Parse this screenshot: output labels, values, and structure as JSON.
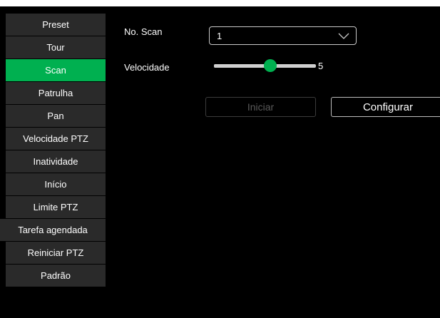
{
  "menu": {
    "items": [
      {
        "label": "Preset"
      },
      {
        "label": "Tour"
      },
      {
        "label": "Scan"
      },
      {
        "label": "Patrulha"
      },
      {
        "label": "Pan"
      },
      {
        "label": "Velocidade PTZ"
      },
      {
        "label": "Inatividade"
      },
      {
        "label": "Início"
      },
      {
        "label": "Limite PTZ"
      },
      {
        "label": "Tarefa agendada"
      },
      {
        "label": "Reiniciar PTZ"
      },
      {
        "label": "Padrão"
      }
    ],
    "active_index": 2
  },
  "form": {
    "scan_no_label": "No. Scan",
    "scan_no_value": "1",
    "speed_label": "Velocidade",
    "speed_value": "5",
    "speed_level_fraction": 0.55
  },
  "buttons": {
    "start_label": "Iniciar",
    "configure_label": "Configurar"
  },
  "colors": {
    "accent": "#00b050",
    "background": "#000000",
    "menu_item": "#2a2a2a"
  }
}
